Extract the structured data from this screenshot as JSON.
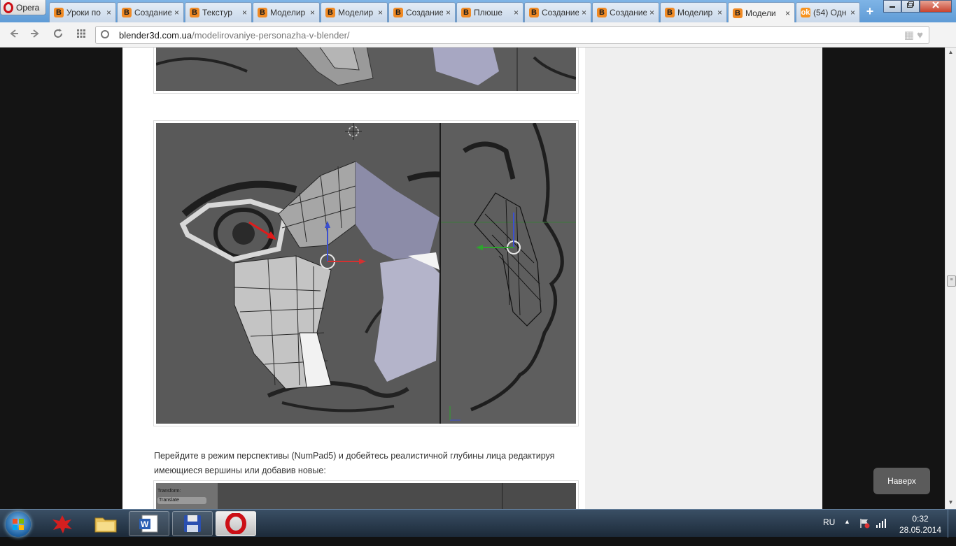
{
  "browser": {
    "menu_label": "Opera",
    "tabs": [
      {
        "title": "Уроки по",
        "favicon": "blender-icon"
      },
      {
        "title": "Создание",
        "favicon": "blender-icon"
      },
      {
        "title": "Текстур",
        "favicon": "blender-icon"
      },
      {
        "title": "Моделир",
        "favicon": "blender-icon"
      },
      {
        "title": "Моделир",
        "favicon": "blender-icon"
      },
      {
        "title": "Создание",
        "favicon": "blender-icon"
      },
      {
        "title": "Плюше",
        "favicon": "blender-icon"
      },
      {
        "title": "Создание",
        "favicon": "blender-icon"
      },
      {
        "title": "Создание",
        "favicon": "blender-icon"
      },
      {
        "title": "Моделир",
        "favicon": "blender-icon"
      },
      {
        "title": "Модели",
        "favicon": "blender-icon",
        "active": true
      },
      {
        "title": "(54) Одн",
        "favicon": "odnoklassniki-icon"
      }
    ],
    "close_glyph": "×",
    "new_tab_glyph": "+",
    "address": {
      "domain": "blender3d.com.ua",
      "path": "/modelirovaniye-personazha-v-blender/"
    }
  },
  "article": {
    "paragraph": "Перейдите в режим перспективы (NumPad5) и добейтесь реалистичной глубины лица редактируя имеющиеся вершины или добавив новые:",
    "bottom_image_labels": {
      "line1": "Transform:",
      "line2": "Translate"
    }
  },
  "back_to_top": "Наверх",
  "taskbar": {
    "language": "RU",
    "time": "0:32",
    "date": "28.05.2014"
  },
  "colors": {
    "accent_opera": "#cc0f16",
    "blender_orange": "#f08a24",
    "viewport_gray": "#5b5b5b"
  }
}
